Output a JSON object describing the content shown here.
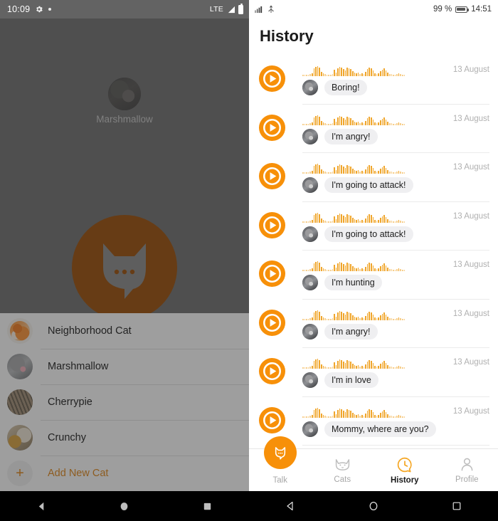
{
  "left": {
    "status": {
      "time": "10:09",
      "network": "LTE",
      "icons": [
        "gear-icon",
        "dot-icon",
        "signal-icon",
        "battery-icon"
      ]
    },
    "selected_cat": {
      "name": "Marshmallow"
    },
    "talk_button": {
      "label": "cat-speech-bubble"
    },
    "cats": [
      {
        "name": "Neighborhood Cat",
        "avatar": "av-neighbor"
      },
      {
        "name": "Marshmallow",
        "avatar": "av-marsh"
      },
      {
        "name": "Cherrypie",
        "avatar": "av-cherry"
      },
      {
        "name": "Crunchy",
        "avatar": "av-crunchy"
      }
    ],
    "add_new": {
      "label": "Add New Cat",
      "icon": "plus-icon"
    }
  },
  "right": {
    "status": {
      "battery_pct": "99 %",
      "time": "14:51",
      "icons": [
        "signal-icon",
        "usb-icon",
        "battery-icon"
      ]
    },
    "title": "History",
    "items": [
      {
        "text": "Boring!",
        "date": "13 August"
      },
      {
        "text": "I'm angry!",
        "date": "13 August"
      },
      {
        "text": "I'm going to attack!",
        "date": "13 August"
      },
      {
        "text": "I'm going to attack!",
        "date": "13 August"
      },
      {
        "text": "I'm hunting",
        "date": "13 August"
      },
      {
        "text": "I'm angry!",
        "date": "13 August"
      },
      {
        "text": "I'm in love",
        "date": "13 August"
      },
      {
        "text": "Mommy, where are you?",
        "date": "13 August"
      }
    ],
    "tabs": [
      {
        "label": "Talk",
        "icon": "cat-speech-icon",
        "active": false
      },
      {
        "label": "Cats",
        "icon": "cat-face-icon",
        "active": false
      },
      {
        "label": "History",
        "icon": "clock-bubble-icon",
        "active": true
      },
      {
        "label": "Profile",
        "icon": "person-icon",
        "active": false
      }
    ]
  },
  "colors": {
    "accent": "#f79009",
    "wave": "#f0a62c",
    "talk_disc": "#9b4e06",
    "scrim": "#6f6f6f",
    "add_label": "#e0871b"
  },
  "android_nav": {
    "back": "back-icon",
    "home": "home-icon",
    "recents": "recents-icon"
  }
}
